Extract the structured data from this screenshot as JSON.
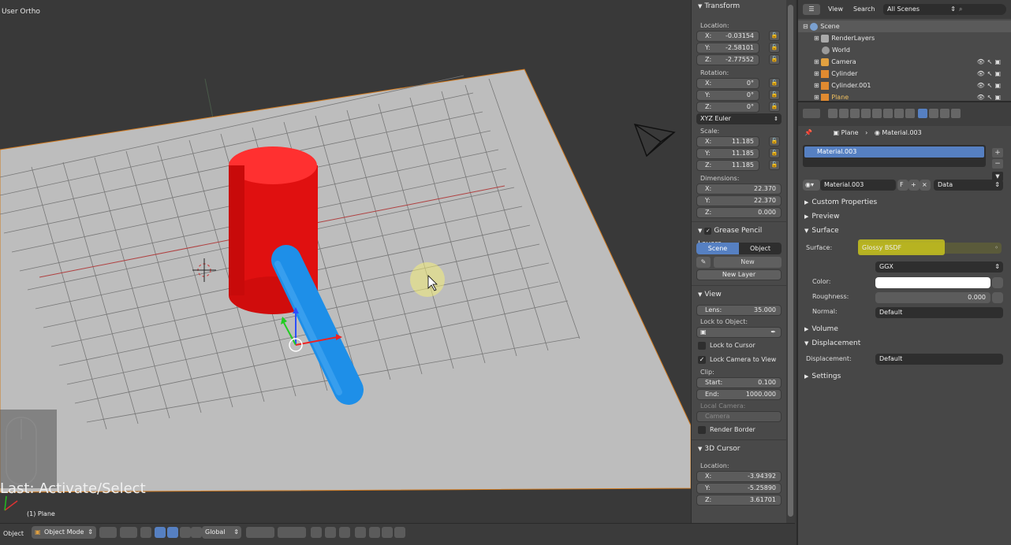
{
  "viewport": {
    "view_label": "User Ortho",
    "last_operator": "Last: Activate/Select",
    "active_object_label": "(1) Plane"
  },
  "npanel": {
    "transform_header": "Transform",
    "location_label": "Location:",
    "location": [
      {
        "axis": "X:",
        "value": "-0.03154"
      },
      {
        "axis": "Y:",
        "value": "-2.58101"
      },
      {
        "axis": "Z:",
        "value": "-2.77552"
      }
    ],
    "rotation_label": "Rotation:",
    "rotation": [
      {
        "axis": "X:",
        "value": "0°"
      },
      {
        "axis": "Y:",
        "value": "0°"
      },
      {
        "axis": "Z:",
        "value": "0°"
      }
    ],
    "rotation_mode": "XYZ Euler",
    "scale_label": "Scale:",
    "scale": [
      {
        "axis": "X:",
        "value": "11.185"
      },
      {
        "axis": "Y:",
        "value": "11.185"
      },
      {
        "axis": "Z:",
        "value": "11.185"
      }
    ],
    "dimensions_label": "Dimensions:",
    "dimensions": [
      {
        "axis": "X:",
        "value": "22.370"
      },
      {
        "axis": "Y:",
        "value": "22.370"
      },
      {
        "axis": "Z:",
        "value": "0.000"
      }
    ],
    "grease_header": "Grease Pencil Layers",
    "grease_scene": "Scene",
    "grease_object": "Object",
    "grease_new": "New",
    "grease_new_layer": "New Layer",
    "view_header": "View",
    "lens_label": "Lens:",
    "lens_value": "35.000",
    "lock_to_object_label": "Lock to Object:",
    "lock_to_cursor": "Lock to Cursor",
    "lock_camera_to_view": "Lock Camera to View",
    "clip_label": "Clip:",
    "clip_start_label": "Start:",
    "clip_start": "0.100",
    "clip_end_label": "End:",
    "clip_end": "1000.000",
    "local_camera_label": "Local Camera:",
    "local_camera_value": "Camera",
    "render_border": "Render Border",
    "cursor_header": "3D Cursor",
    "cursor_location_label": "Location:",
    "cursor_location": [
      {
        "axis": "X:",
        "value": "-3.94392"
      },
      {
        "axis": "Y:",
        "value": "-5.25890"
      },
      {
        "axis": "Z:",
        "value": "3.61701"
      }
    ]
  },
  "outliner": {
    "view_menu": "View",
    "search_menu": "Search",
    "scene_filter": "All Scenes",
    "items": [
      {
        "name": "Scene",
        "indent": 0
      },
      {
        "name": "RenderLayers",
        "indent": 1
      },
      {
        "name": "World",
        "indent": 1
      },
      {
        "name": "Camera",
        "indent": 1
      },
      {
        "name": "Cylinder",
        "indent": 1
      },
      {
        "name": "Cylinder.001",
        "indent": 1
      },
      {
        "name": "Plane",
        "indent": 1
      }
    ]
  },
  "properties": {
    "breadcrumb_object": "Plane",
    "breadcrumb_material": "Material.003",
    "material_slot": "Material.003",
    "material_name": "Material.003",
    "material_fake_user": "F",
    "link_data": "Data",
    "sections": {
      "custom_properties": "Custom Properties",
      "preview": "Preview",
      "surface": "Surface",
      "volume": "Volume",
      "displacement": "Displacement",
      "settings": "Settings"
    },
    "surface_label": "Surface:",
    "surface_shader": "Glossy BSDF",
    "distribution": "GGX",
    "color_label": "Color:",
    "roughness_label": "Roughness:",
    "roughness_value": "0.000",
    "normal_label": "Normal:",
    "normal_value": "Default",
    "displacement_label": "Displacement:",
    "displacement_value": "Default",
    "highlight_color": "#d7d21a",
    "color_value": "#ffffff"
  },
  "footer": {
    "object_menu": "Object",
    "mode": "Object Mode",
    "orientation": "Global"
  },
  "colors": {
    "accent": "#5680c2",
    "cylinder_red": "#e01010",
    "cylinder_blue": "#1e8fe8",
    "plane": "#bdbdbd"
  }
}
